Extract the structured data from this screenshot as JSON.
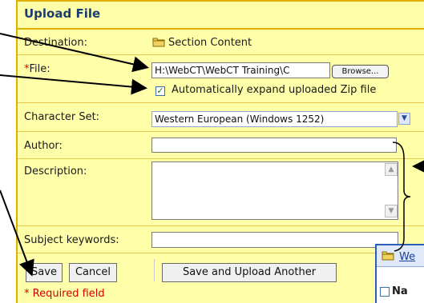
{
  "dialog": {
    "title": "Upload File",
    "destination": {
      "label": "Destination:",
      "folder_icon": "folder-icon",
      "value": "Section Content"
    },
    "file": {
      "required_marker": "*",
      "label": "File:",
      "value": "H:\\WebCT\\WebCT Training\\C",
      "browse_label": "Browse..."
    },
    "zip": {
      "checked": true,
      "label": "Automatically expand uploaded Zip file"
    },
    "charset": {
      "label": "Character Set:",
      "value": "Western European (Windows 1252)"
    },
    "author": {
      "label": "Author:",
      "value": ""
    },
    "description": {
      "label": "Description:",
      "value": ""
    },
    "keywords": {
      "label": "Subject keywords:",
      "value": ""
    },
    "buttons": {
      "save": "Save",
      "cancel": "Cancel",
      "save_upload_another": "Save and Upload Another"
    },
    "required_note": "* Required field"
  },
  "popup": {
    "link": "We",
    "row_label": "Na"
  },
  "colors": {
    "panel_bg": "#ffffaa",
    "border": "#e0b000",
    "title": "#1a3d6e",
    "required": "#d40000",
    "arrow": "#000000"
  }
}
